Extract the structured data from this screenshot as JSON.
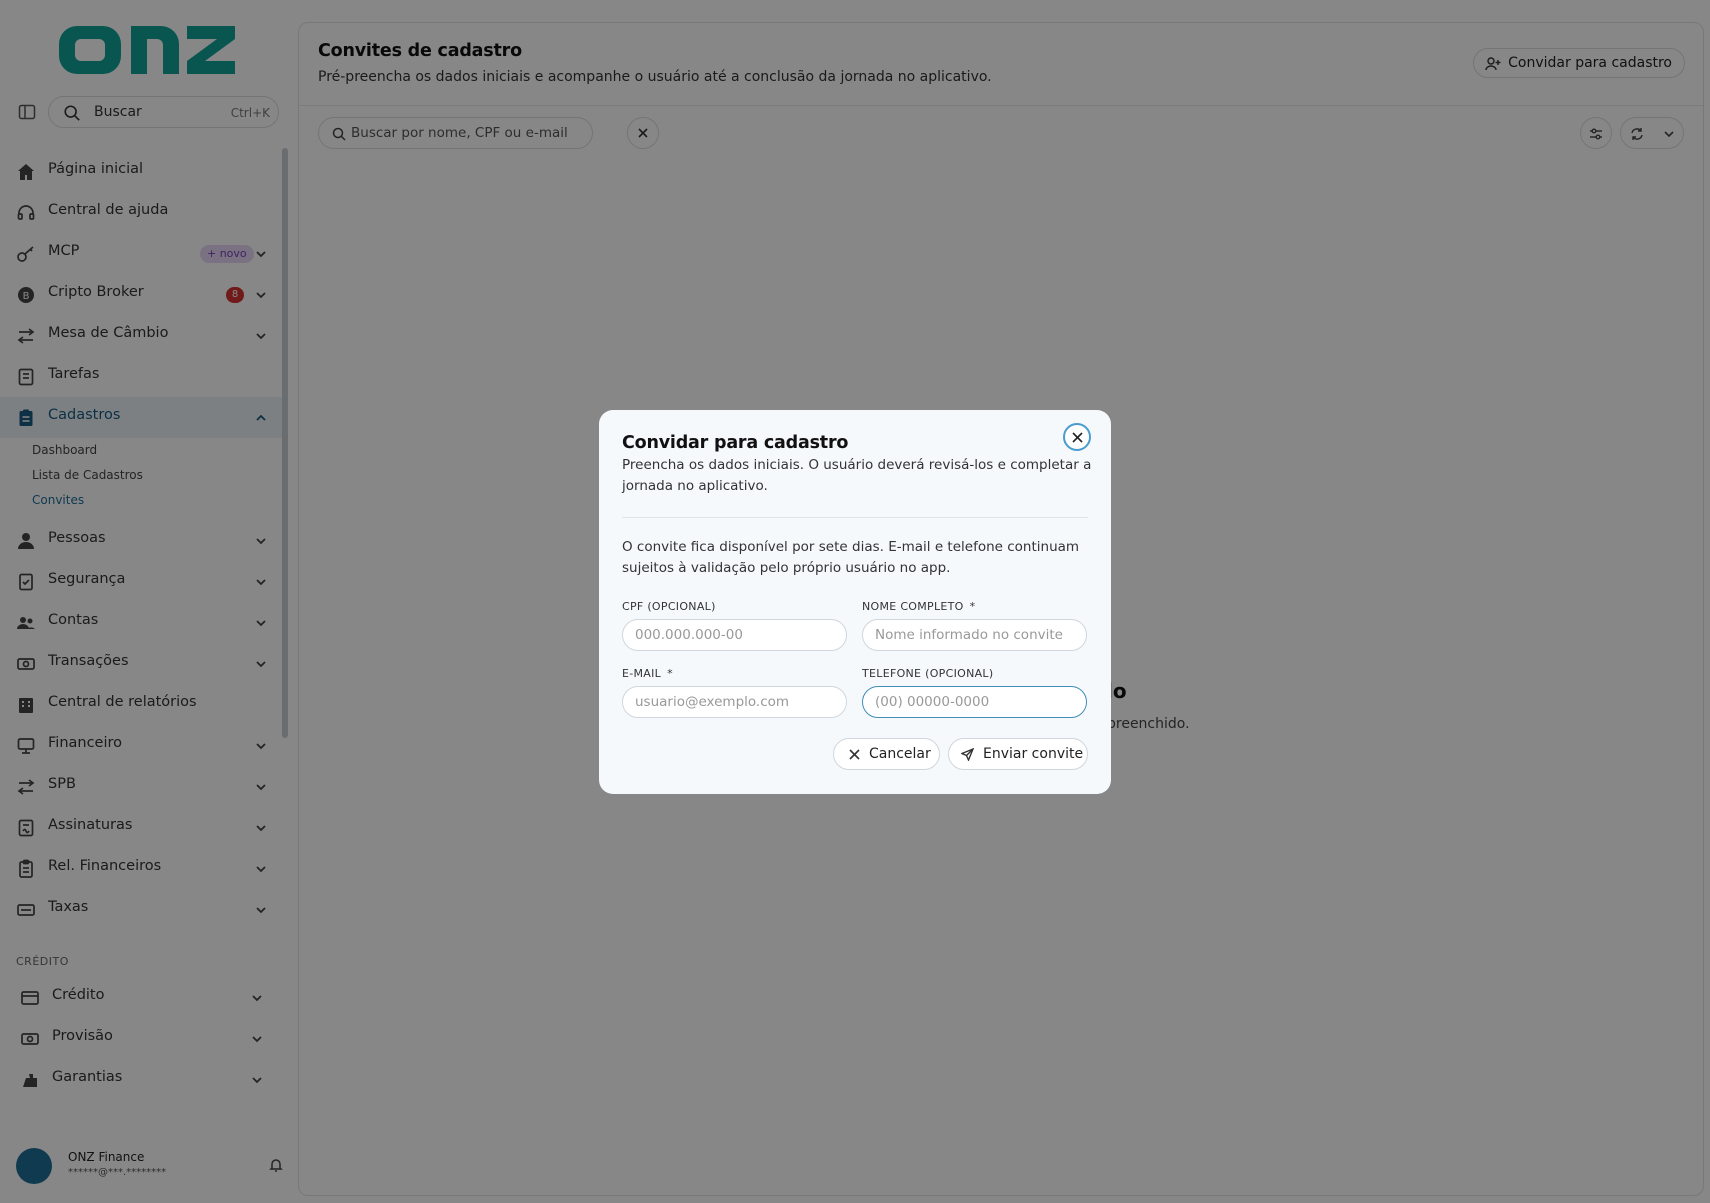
{
  "brand": {
    "logo_text": "onz",
    "accent_color": "#12a39a"
  },
  "sidebar": {
    "search": {
      "label": "Buscar",
      "shortcut": "Ctrl+K"
    },
    "items": [
      {
        "label": "Página inicial",
        "icon": "home-icon"
      },
      {
        "label": "Central de ajuda",
        "icon": "headset-icon"
      },
      {
        "label": "MCP",
        "icon": "key-icon",
        "badge": "+ novo"
      },
      {
        "label": "Cripto Broker",
        "icon": "bitcoin-icon",
        "badge": "8"
      },
      {
        "label": "Mesa de Câmbio",
        "icon": "exchange-icon"
      },
      {
        "label": "Tarefas",
        "icon": "tasks-icon"
      },
      {
        "label": "Cadastros",
        "icon": "clipboard-icon",
        "expanded": true
      },
      {
        "label": "Pessoas",
        "icon": "person-icon"
      },
      {
        "label": "Segurança",
        "icon": "shield-icon"
      },
      {
        "label": "Contas",
        "icon": "users-icon"
      },
      {
        "label": "Transações",
        "icon": "money-icon"
      },
      {
        "label": "Central de relatórios",
        "icon": "building-icon"
      },
      {
        "label": "Financeiro",
        "icon": "monitor-icon"
      },
      {
        "label": "SPB",
        "icon": "transfer-icon"
      },
      {
        "label": "Assinaturas",
        "icon": "signature-icon"
      },
      {
        "label": "Rel. Financeiros",
        "icon": "report-icon"
      },
      {
        "label": "Taxas",
        "icon": "fees-icon"
      }
    ],
    "subitems": [
      "Dashboard",
      "Lista de Cadastros",
      "Convites"
    ],
    "section_label": "CRÉDITO",
    "credit_items": [
      {
        "label": "Crédito",
        "icon": "card-icon"
      },
      {
        "label": "Provisão",
        "icon": "cash-icon"
      },
      {
        "label": "Garantias",
        "icon": "guarantee-icon"
      }
    ],
    "user": {
      "name": "ONZ Finance",
      "email": "******@***.********"
    }
  },
  "main": {
    "title": "Convites de cadastro",
    "subtitle": "Pré-preencha os dados iniciais e acompanhe o usuário até a conclusão da jornada no aplicativo.",
    "invite_button": "Convidar para cadastro",
    "search_placeholder": "Buscar por nome, CPF ou e-mail",
    "empty_title_fragment": "lo",
    "empty_sub_fragment": "preenchido."
  },
  "modal": {
    "title": "Convidar para cadastro",
    "description": "Preencha os dados iniciais. O usuário deverá revisá-los e completar a jornada no aplicativo.",
    "info": "O convite fica disponível por sete dias. E-mail e telefone continuam sujeitos à validação pelo próprio usuário no app.",
    "fields": {
      "cpf": {
        "label": "CPF (OPCIONAL)",
        "placeholder": "000.000.000-00"
      },
      "name": {
        "label": "NOME COMPLETO",
        "required": "*",
        "placeholder": "Nome informado no convite"
      },
      "email": {
        "label": "E-MAIL",
        "required": "*",
        "placeholder": "usuario@exemplo.com"
      },
      "phone": {
        "label": "TELEFONE (OPCIONAL)",
        "placeholder": "(00) 00000-0000"
      }
    },
    "cancel": "Cancelar",
    "submit": "Enviar convite"
  }
}
